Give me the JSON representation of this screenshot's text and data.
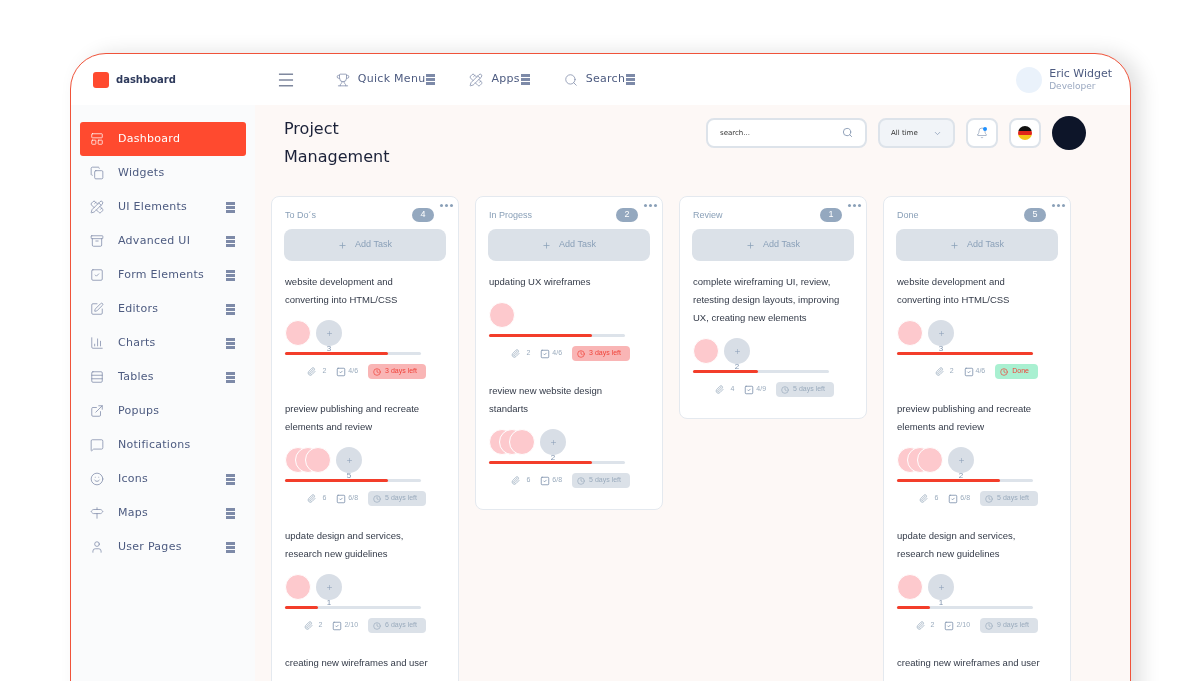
{
  "header": {
    "logo": "dashboard",
    "nav": [
      {
        "label": "Quick Menu"
      },
      {
        "label": "Apps"
      },
      {
        "label": "Search"
      }
    ],
    "user": {
      "name": "Eric Widget",
      "role": "Developer"
    }
  },
  "sidebar": {
    "items": [
      {
        "label": "Dashboard",
        "selected": true,
        "has_submenu": false
      },
      {
        "label": "Widgets",
        "selected": false,
        "has_submenu": false
      },
      {
        "label": "UI Elements",
        "selected": false,
        "has_submenu": true
      },
      {
        "label": "Advanced UI",
        "selected": false,
        "has_submenu": true
      },
      {
        "label": "Form Elements",
        "selected": false,
        "has_submenu": true
      },
      {
        "label": "Editors",
        "selected": false,
        "has_submenu": true
      },
      {
        "label": "Charts",
        "selected": false,
        "has_submenu": true
      },
      {
        "label": "Tables",
        "selected": false,
        "has_submenu": true
      },
      {
        "label": "Popups",
        "selected": false,
        "has_submenu": false
      },
      {
        "label": "Notifications",
        "selected": false,
        "has_submenu": false
      },
      {
        "label": "Icons",
        "selected": false,
        "has_submenu": true
      },
      {
        "label": "Maps",
        "selected": false,
        "has_submenu": true
      },
      {
        "label": "User Pages",
        "selected": false,
        "has_submenu": true
      }
    ]
  },
  "page": {
    "title": "Project Management",
    "search": {
      "placeholder": "search..."
    },
    "period": "All time",
    "notification_unread": true
  },
  "columns": [
    {
      "title": "To Do´s",
      "count": "4",
      "add_label": "Add Task",
      "tasks": [
        {
          "text": "website development and converting into HTML/CSS",
          "avatars": [
            {
              "kind": "avatar"
            }
          ],
          "more": "3",
          "level": 0.76,
          "attachments": "2",
          "checklist": "4/6",
          "deadline": {
            "text": "3 days left",
            "kind": "urgent"
          }
        },
        {
          "text": "preview publishing and recreate elements and review",
          "avatars": [
            {
              "kind": "avatar"
            },
            {
              "kind": "avatar"
            },
            {
              "kind": "avatar"
            }
          ],
          "more": "5",
          "level": 0.76,
          "attachments": "6",
          "checklist": "6/8",
          "deadline": {
            "text": "5 days left",
            "kind": "normal"
          }
        },
        {
          "text": "update design and services, research new guidelines",
          "avatars": [
            {
              "kind": "avatar"
            }
          ],
          "more": "1",
          "level": 0.24,
          "attachments": "2",
          "checklist": "2/10",
          "deadline": {
            "text": "6 days left",
            "kind": "normal"
          }
        },
        {
          "text": "creating new wireframes and user"
        }
      ]
    },
    {
      "title": "In Progess",
      "count": "2",
      "add_label": "Add Task",
      "tasks": [
        {
          "text": "updating UX wireframes",
          "avatars": [
            {
              "kind": "avatar"
            }
          ],
          "level": 0.76,
          "attachments": "2",
          "checklist": "4/6",
          "deadline": {
            "text": "3 days left",
            "kind": "urgent"
          }
        },
        {
          "text": "review new website design standarts",
          "avatars": [
            {
              "kind": "avatar"
            },
            {
              "kind": "avatar"
            },
            {
              "kind": "avatar"
            }
          ],
          "more": "2",
          "level": 0.76,
          "attachments": "6",
          "checklist": "6/8",
          "deadline": {
            "text": "5 days left",
            "kind": "normal"
          }
        }
      ]
    },
    {
      "title": "Review",
      "count": "1",
      "add_label": "Add Task",
      "tasks": [
        {
          "text": "complete wireframing UI, review, retesting design layouts, improving UX, creating new elements",
          "avatars": [
            {
              "kind": "avatar"
            }
          ],
          "more": "2",
          "level": 0.48,
          "attachments": "4",
          "checklist": "4/9",
          "deadline": {
            "text": "5 days left",
            "kind": "normal"
          }
        }
      ]
    },
    {
      "title": "Done",
      "count": "5",
      "add_label": "Add Task",
      "tasks": [
        {
          "text": "website development and converting into HTML/CSS",
          "avatars": [
            {
              "kind": "avatar"
            }
          ],
          "more": "3",
          "level": 1,
          "attachments": "2",
          "checklist": "4/6",
          "deadline": {
            "text": "Done",
            "kind": "done"
          }
        },
        {
          "text": "preview publishing and recreate elements and review",
          "avatars": [
            {
              "kind": "avatar"
            },
            {
              "kind": "avatar"
            },
            {
              "kind": "avatar"
            }
          ],
          "more": "2",
          "level": 0.76,
          "attachments": "6",
          "checklist": "6/8",
          "deadline": {
            "text": "5 days left",
            "kind": "normal"
          }
        },
        {
          "text": "update design and services, research new guidelines",
          "avatars": [
            {
              "kind": "avatar"
            }
          ],
          "more": "1",
          "level": 0.24,
          "attachments": "2",
          "checklist": "2/10",
          "deadline": {
            "text": "9 days left",
            "kind": "normal"
          }
        },
        {
          "text": "creating new wireframes and user"
        }
      ]
    }
  ]
}
